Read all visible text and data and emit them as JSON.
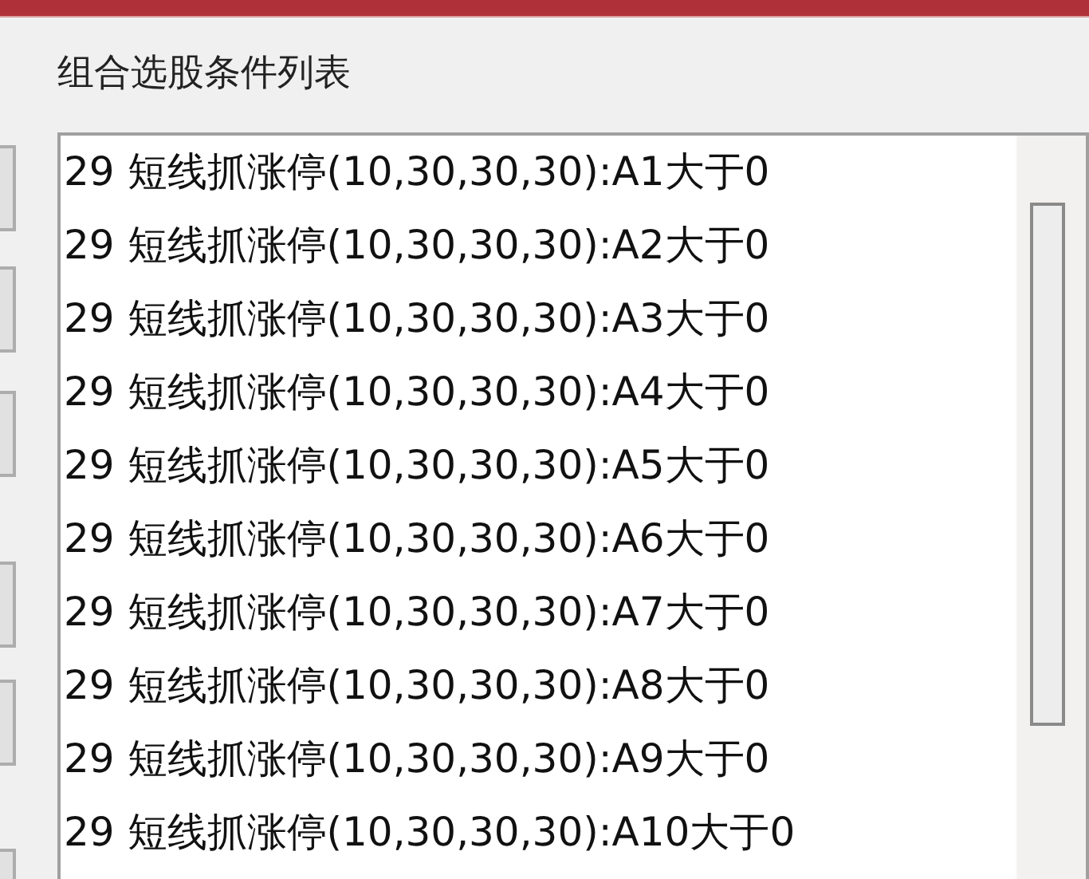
{
  "title": "组合选股条件列表",
  "side_buttons": [
    {
      "kind": "button"
    },
    {
      "kind": "button"
    },
    {
      "kind": "button"
    },
    {
      "kind": "button"
    },
    {
      "kind": "button"
    },
    {
      "kind": "button"
    }
  ],
  "conditions": [
    "29 短线抓涨停(10,30,30,30):A1大于0",
    "29 短线抓涨停(10,30,30,30):A2大于0",
    "29 短线抓涨停(10,30,30,30):A3大于0",
    "29 短线抓涨停(10,30,30,30):A4大于0",
    "29 短线抓涨停(10,30,30,30):A5大于0",
    "29 短线抓涨停(10,30,30,30):A6大于0",
    "29 短线抓涨停(10,30,30,30):A7大于0",
    "29 短线抓涨停(10,30,30,30):A8大于0",
    "29 短线抓涨停(10,30,30,30):A9大于0",
    "29 短线抓涨停(10,30,30,30):A10大于0"
  ]
}
